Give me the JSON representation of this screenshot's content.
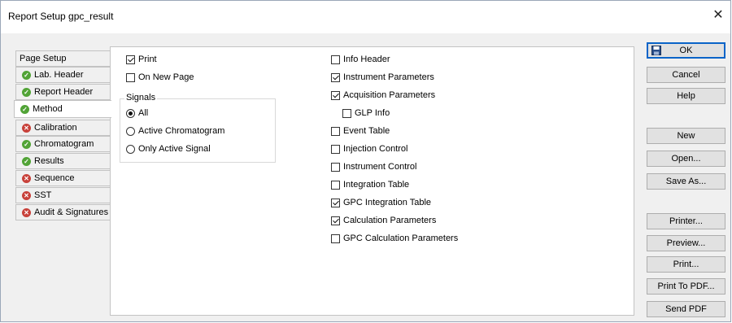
{
  "window": {
    "title": "Report Setup gpc_result",
    "close_glyph": "✕"
  },
  "tabs": [
    {
      "label": "Page Setup",
      "status": "none"
    },
    {
      "label": "Lab. Header",
      "status": "ok"
    },
    {
      "label": "Report Header",
      "status": "ok"
    },
    {
      "label": "Method",
      "status": "ok",
      "active": true
    },
    {
      "label": "Calibration",
      "status": "err"
    },
    {
      "label": "Chromatogram",
      "status": "ok"
    },
    {
      "label": "Results",
      "status": "ok"
    },
    {
      "label": "Sequence",
      "status": "err"
    },
    {
      "label": "SST",
      "status": "err"
    },
    {
      "label": "Audit & Signatures",
      "status": "err"
    }
  ],
  "left_options": {
    "print": {
      "label": "Print",
      "checked": true
    },
    "on_new_page": {
      "label": "On New Page",
      "checked": false
    }
  },
  "signals": {
    "label": "Signals",
    "options": [
      {
        "label": "All",
        "selected": true
      },
      {
        "label": "Active Chromatogram",
        "selected": false
      },
      {
        "label": "Only Active Signal",
        "selected": false
      }
    ]
  },
  "right_options": [
    {
      "label": "Info Header",
      "checked": false
    },
    {
      "label": "Instrument Parameters",
      "checked": true
    },
    {
      "label": "Acquisition Parameters",
      "checked": true
    },
    {
      "label": "GLP Info",
      "checked": false
    },
    {
      "label": "Event Table",
      "checked": false
    },
    {
      "label": "Injection Control",
      "checked": false
    },
    {
      "label": "Instrument Control",
      "checked": false
    },
    {
      "label": "Integration Table",
      "checked": false
    },
    {
      "label": "GPC Integration Table",
      "checked": true
    },
    {
      "label": "Calculation Parameters",
      "checked": true
    },
    {
      "label": "GPC Calculation Parameters",
      "checked": false
    }
  ],
  "buttons": {
    "ok": "OK",
    "cancel": "Cancel",
    "help": "Help",
    "new": "New",
    "open": "Open...",
    "save_as": "Save As...",
    "printer": "Printer...",
    "preview": "Preview...",
    "print": "Print...",
    "print_to_pdf": "Print To PDF...",
    "send_pdf": "Send PDF"
  },
  "colors": {
    "ok": "#51a336",
    "error": "#c8413a",
    "accent": "#0a64c8"
  }
}
